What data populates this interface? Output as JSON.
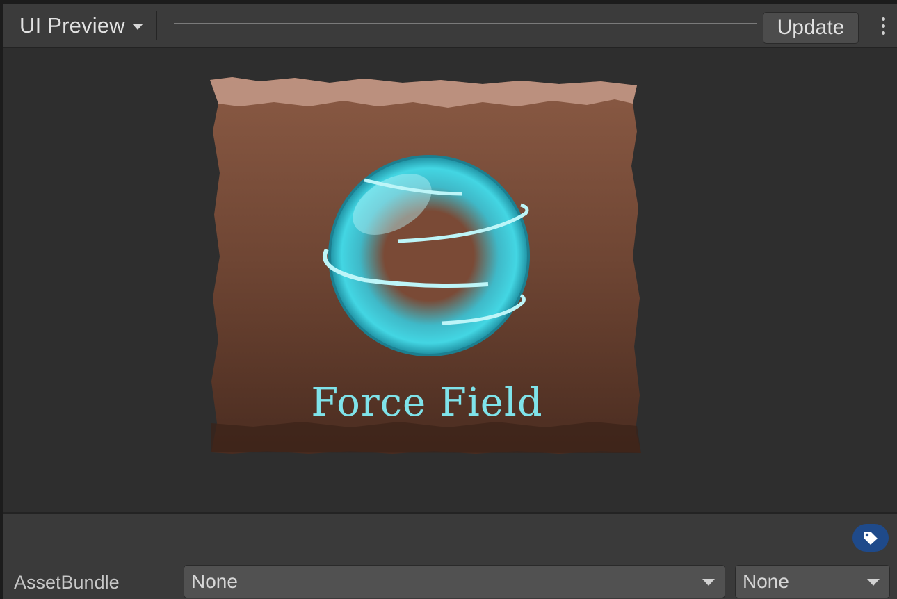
{
  "toolbar": {
    "title": "UI Preview",
    "update_label": "Update"
  },
  "preview": {
    "asset_title": "Force Field"
  },
  "assetbundle": {
    "label": "AssetBundle",
    "name_value": "None",
    "variant_value": "None"
  },
  "colors": {
    "accent_cyan": "#7fe3ea",
    "tag_badge": "#1f4a8a"
  },
  "icons": [
    "chevron-down-icon",
    "kebab-menu-icon",
    "tag-icon",
    "force-field-orb-icon"
  ]
}
